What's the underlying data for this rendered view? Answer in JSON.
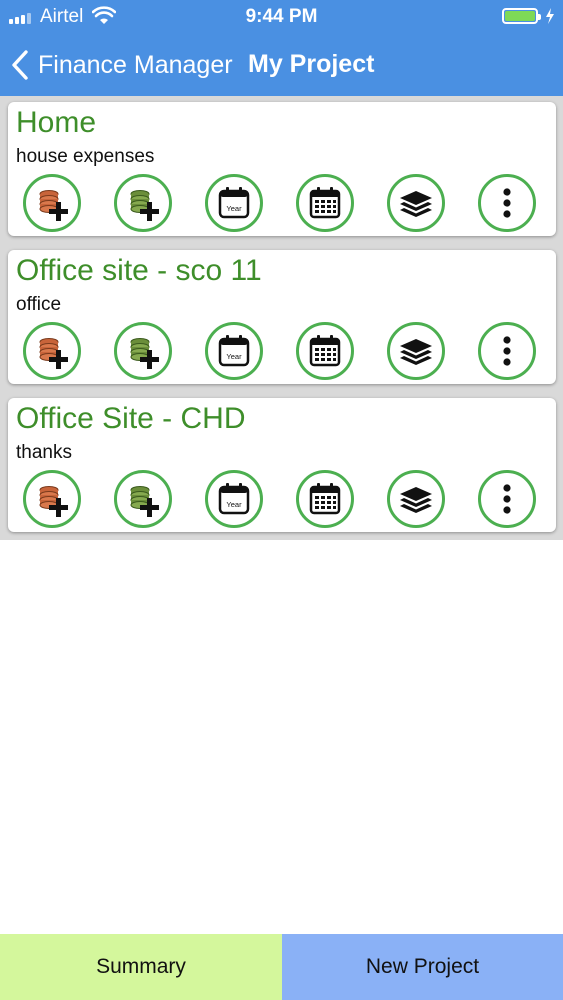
{
  "status_bar": {
    "carrier": "Airtel",
    "time": "9:44 PM",
    "battery_color": "#7ed957"
  },
  "nav": {
    "back_label": "Finance Manager",
    "title": "My Project",
    "back_icon": "chevron-left-icon",
    "bar_color": "#4a90e2"
  },
  "projects": [
    {
      "title": "Home",
      "description": "house expenses"
    },
    {
      "title": "Office site - sco 11",
      "description": "office"
    },
    {
      "title": "Office Site - CHD",
      "description": "thanks"
    }
  ],
  "project_actions": {
    "icons": [
      "add-expense-coins-icon",
      "add-income-coins-icon",
      "year-calendar-icon",
      "month-calendar-icon",
      "layers-icon",
      "more-vertical-icon"
    ],
    "year_label": "Year",
    "ring_color": "#4caf50"
  },
  "bottom_bar": {
    "summary_label": "Summary",
    "new_project_label": "New Project",
    "summary_color": "#d4f79c",
    "new_project_color": "#8ab1f6"
  },
  "colors": {
    "title_green": "#3e8e2a",
    "list_background": "#d9d9d9"
  }
}
